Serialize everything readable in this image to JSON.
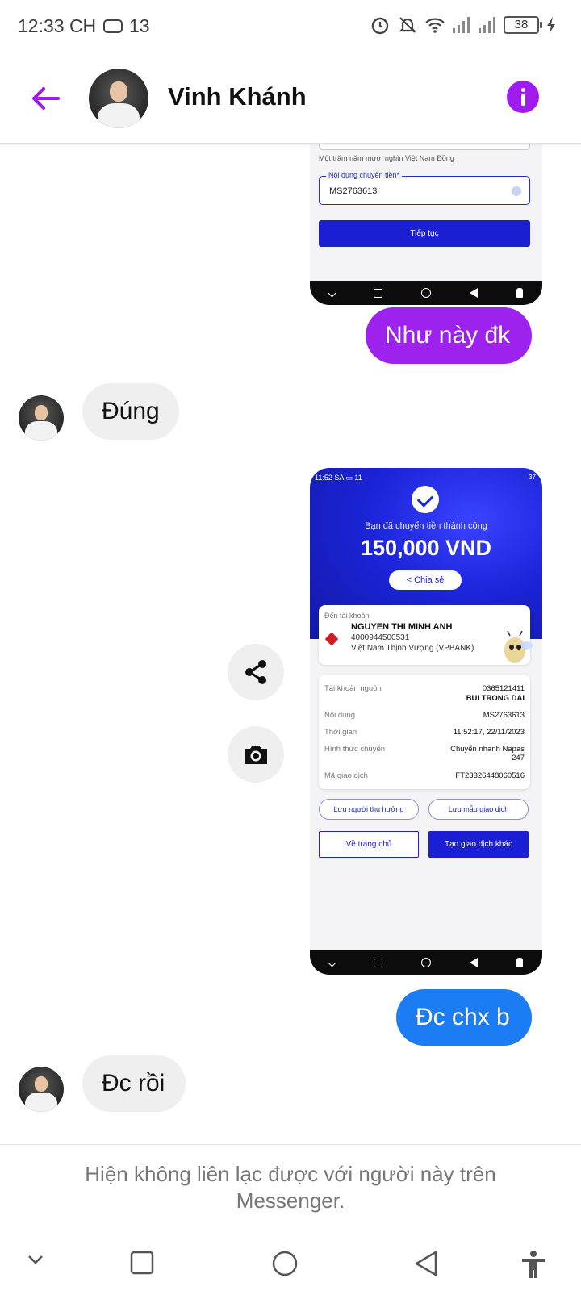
{
  "status_bar": {
    "time": "12:33 CH",
    "notification_count": "13",
    "battery": "38"
  },
  "header": {
    "contact_name": "Vinh Khánh"
  },
  "messages": [
    {
      "from": "me",
      "text": "Như này đk",
      "bubble_color": "#9d22ee"
    },
    {
      "from": "contact",
      "text": "Đúng"
    },
    {
      "from": "me",
      "text": "Đc chx b",
      "bubble_color": "#1b7cf4"
    },
    {
      "from": "contact",
      "text": "Đc rồi"
    }
  ],
  "screenshot_1": {
    "amount_in_words": "Một trăm năm mươi nghìn Việt Nam Đồng",
    "field_label": "Nội dung chuyển tiền*",
    "field_value": "MS2763613",
    "continue_button": "Tiếp tục"
  },
  "screenshot_2": {
    "mini_time": "11:52 SA",
    "mini_count": "11",
    "mini_battery": "37",
    "success_text": "Bạn đã chuyển tiền thành công",
    "amount": "150,000 VND",
    "share_label": "Chia sẻ",
    "dest_label": "Đến tài khoản",
    "dest_name": "NGUYEN THI MINH ANH",
    "dest_account": "4000944500531",
    "dest_bank": "Việt Nam Thịnh Vượng (VPBANK)",
    "rows": {
      "source_key": "Tài khoản nguồn",
      "source_acc": "0365121411",
      "source_name": "BUI TRONG DAI",
      "content_key": "Nội dung",
      "content_val": "MS2763613",
      "time_key": "Thời gian",
      "time_val": "11:52:17, 22/11/2023",
      "method_key": "Hình thức chuyển",
      "method_val": "Chuyển nhanh Napas 247",
      "txn_key": "Mã giao dịch",
      "txn_val": "FT23326448060516"
    },
    "save_beneficiary": "Lưu người thụ hưởng",
    "save_template": "Lưu mẫu giao dịch",
    "home_button": "Về trang chủ",
    "new_txn_button": "Tạo giao dịch khác"
  },
  "footer": {
    "message": "Hiện không liên lạc được với người này trên Messenger."
  },
  "colors": {
    "accent": "#a01bef",
    "bank_blue": "#1b1fd3"
  }
}
